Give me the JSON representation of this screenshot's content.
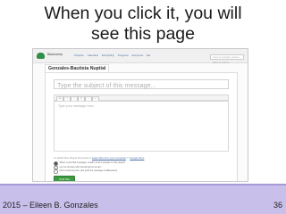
{
  "slide": {
    "title_line1": "When you click it, you will",
    "title_line2": "see this page",
    "footer_left": "2015 – Eileen B. Gonzales",
    "page_number": "36",
    "footer_color": "#c8bfeb"
  },
  "app": {
    "name": "Basecamp",
    "nav": [
      "Projects",
      "Calendar",
      "Everything",
      "Progress",
      "Everyone",
      "Me"
    ],
    "search_placeholder": "Jump to a project, person, label, or search...",
    "project_name": "Gonzales-Bautista Nuptial"
  },
  "message": {
    "subject_placeholder": "Type the subject of this message...",
    "body_placeholder": "Type your message here...",
    "toolbar": [
      "B",
      "I",
      "•",
      "1.",
      "“",
      "↩"
    ],
    "attach_text": "To attach files drag & drop here or",
    "attach_link1": "select files from your computer",
    "attach_link2": "Google Drive",
    "options": [
      "When I post this message, email it to all 4 people on this project",
      "Let me choose who should get an email...",
      "Don't email anyone, just post the message to Basecamp"
    ],
    "post_label": "Post this message"
  }
}
